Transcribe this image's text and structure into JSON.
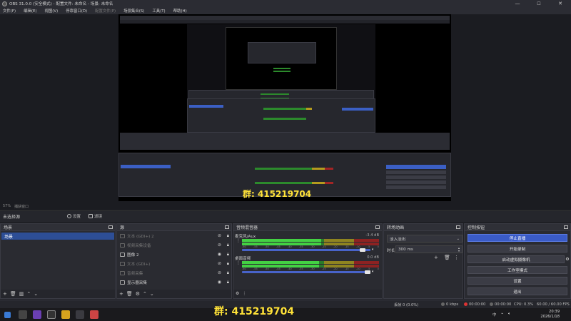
{
  "window": {
    "title": "OBS 31.0.0 (安全模式) - 配置文件: 未命名 - 场景: 未命名",
    "controls": {
      "minimize": "—",
      "maximize": "☐",
      "close": "✕"
    }
  },
  "menu": [
    {
      "label": "文件(F)",
      "enabled": true
    },
    {
      "label": "编辑(E)",
      "enabled": true
    },
    {
      "label": "视图(V)",
      "enabled": true
    },
    {
      "label": "停靠窗口(D)",
      "enabled": true
    },
    {
      "label": "配置文件(P)",
      "enabled": false
    },
    {
      "label": "场景集合(S)",
      "enabled": true
    },
    {
      "label": "工具(T)",
      "enabled": true
    },
    {
      "label": "帮助(H)",
      "enabled": true
    }
  ],
  "preview": {
    "zoom": "57%",
    "mode_label": "捕获窗口",
    "overlay_text_1": "群: 415219704",
    "overlay_text_2": "一 完简"
  },
  "source_toolbar": {
    "no_selection": "未选择源",
    "properties": "设置",
    "filters": "滤镜"
  },
  "scenes": {
    "title": "场景",
    "items": [
      "场景"
    ]
  },
  "sources": {
    "title": "源",
    "items": [
      {
        "label": "文本 (GDI+) 2",
        "visible": false,
        "icon": "text-icon"
      },
      {
        "label": "视频采集设备",
        "visible": false,
        "icon": "camera-icon"
      },
      {
        "label": "图像 2",
        "visible": true,
        "icon": "image-icon"
      },
      {
        "label": "文本 (GDI+)",
        "visible": false,
        "icon": "text-icon"
      },
      {
        "label": "音频采集",
        "visible": false,
        "icon": "audio-icon"
      },
      {
        "label": "显示器采集",
        "visible": true,
        "icon": "monitor-icon"
      }
    ]
  },
  "mixer": {
    "title": "音频混音器",
    "channels": [
      {
        "name": "麦克风/Aux",
        "db": "-3.4 dB",
        "level": 0.58,
        "fader": 0.96
      },
      {
        "name": "桌面音频",
        "db": "0.0 dB",
        "level": 0.56,
        "fader": 1.0
      }
    ],
    "scale": [
      "-60",
      "-55",
      "-50",
      "-45",
      "-40",
      "-35",
      "-30",
      "-25",
      "-20",
      "-15",
      "-10",
      "-5",
      "0"
    ]
  },
  "transitions": {
    "title": "转场动画",
    "selected": "淡入淡出",
    "duration_label": "时长",
    "duration": "300 ms"
  },
  "controls": {
    "title": "控制按钮",
    "stop_stream": "停止直播",
    "start_record": "开始录制",
    "start_virtualcam": "启动虚拟摄像机",
    "studio_mode": "工作室模式",
    "settings": "设置",
    "exit": "退出"
  },
  "status": {
    "dropped_frames": "丢帧 0 (0.0%)",
    "bitrate": "0 kbps",
    "stream_time": "00:00:00",
    "record_time": "00:00:00",
    "cpu": "CPU: 0.3%",
    "fps": "60.00 / 60.00 FPS"
  },
  "taskbar": {
    "time": "20:39",
    "date": "2026/1/18",
    "tray_lang": "中"
  },
  "colors": {
    "accent": "#3a5bc7",
    "meter_green": "#43d143",
    "overlay_yellow": "#ffe238"
  }
}
